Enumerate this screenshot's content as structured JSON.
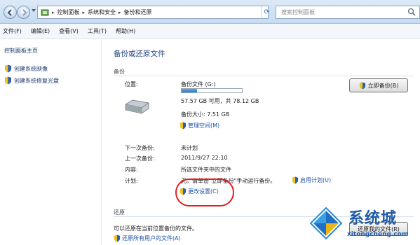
{
  "window": {
    "breadcrumb": [
      "控制面板",
      "系统和安全",
      "备份和还原"
    ],
    "search_placeholder": "搜索控制面板"
  },
  "menu": [
    "文件(F)",
    "编辑(E)",
    "查看(V)",
    "工具(T)",
    "帮助(H)"
  ],
  "sidebar": {
    "home": "控制面板主页",
    "tasks": [
      "创建系统映像",
      "创建系统修复光盘"
    ]
  },
  "main": {
    "title": "备份或还原文件",
    "backup": {
      "section": "备份",
      "location_label": "位置:",
      "location_value": "备份文件 (G:)",
      "usage_fraction": 0.26,
      "space_text": "57.57 GB 可用，共 78.12 GB",
      "size_text": "备份大小: 7.51 GB",
      "manage_space": "管理空间(M)",
      "backup_now": "立即备份(B)",
      "next_label": "下一次备份:",
      "next_value": "未计划",
      "last_label": "上一次备份:",
      "last_value": "2011/9/27 22:10",
      "content_label": "内容:",
      "content_value": "所选文件夹中的文件",
      "schedule_label": "计划:",
      "schedule_value": "无。请单击\"立即备份\"手动运行备份。",
      "enable_schedule": "启用计划(U)",
      "change_settings": "更改设置(C)"
    },
    "restore": {
      "section": "还原",
      "text": "可以还原在当前位置备份的文件。",
      "restore_all_users": "还原所有用户的文件(A)",
      "restore_files_button": "还原我的文件(R)"
    }
  },
  "watermark": {
    "brand": "系统城",
    "site": "xitongcheng.com"
  },
  "colors": {
    "link": "#1c52a8",
    "title": "#1f3f7a",
    "highlight_circle": "#e02020"
  }
}
